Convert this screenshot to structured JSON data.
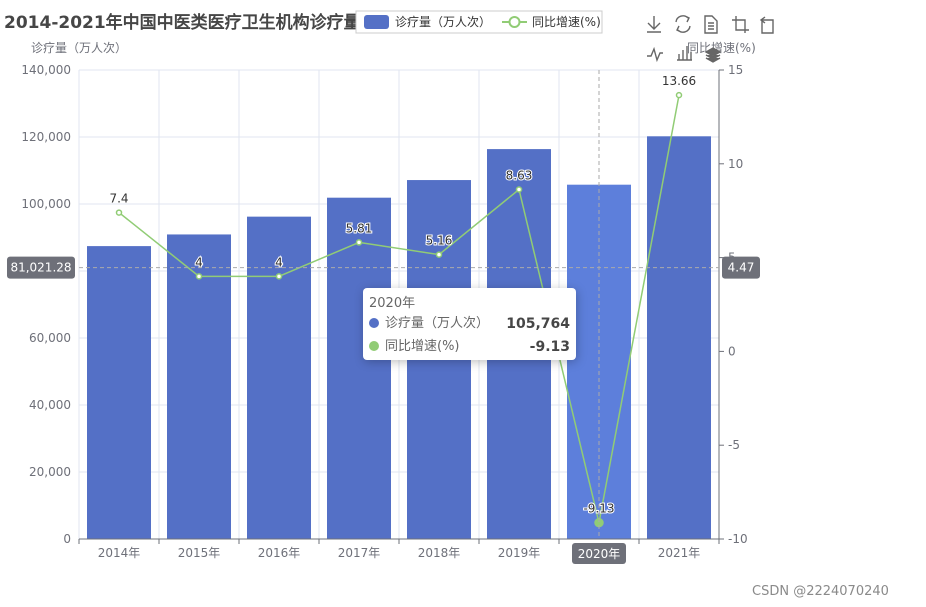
{
  "chart_data": {
    "type": "bar",
    "title": "2014-2021年中国中医类医疗卫生机构诊疗量",
    "categories": [
      "2014年",
      "2015年",
      "2016年",
      "2017年",
      "2018年",
      "2019年",
      "2020年",
      "2021年"
    ],
    "series": [
      {
        "name": "诊疗量（万人次）",
        "type": "bar",
        "axis": "left",
        "color": "#5470c6",
        "values": [
          87431,
          90912,
          96225,
          101885,
          107147,
          116390,
          105764,
          120213
        ]
      },
      {
        "name": "同比增速(%)",
        "type": "line",
        "axis": "right",
        "color": "#91cc75",
        "values": [
          7.4,
          4,
          4,
          5.81,
          5.16,
          8.63,
          -9.13,
          13.66
        ],
        "labels": [
          "7.4",
          "4",
          "4",
          "5.81",
          "5.16",
          "8.63",
          "-9.13",
          "13.66"
        ]
      }
    ],
    "y_left": {
      "name": "诊疗量（万人次）",
      "min": 0,
      "max": 140000,
      "interval": 20000,
      "tick_labels": [
        "0",
        "20,000",
        "40,000",
        "60,000",
        "80,000",
        "100,000",
        "120,000",
        "140,000"
      ]
    },
    "y_right": {
      "name": "同比增速(%)",
      "min": -10,
      "max": 15,
      "interval": 5,
      "tick_labels": [
        "-10",
        "-5",
        "0",
        "5",
        "10",
        "15"
      ]
    },
    "legend_position": "top-center",
    "grid": true
  },
  "axis_pointer": {
    "left_value": 81021.28,
    "left_label": "81,021.28",
    "right_value": 4.47,
    "right_label": "4.47",
    "category_label": "2020年",
    "category_index": 6
  },
  "tooltip": {
    "title": "2020年",
    "rows": [
      {
        "name": "诊疗量（万人次）",
        "value": "105,764",
        "color": "#5470c6"
      },
      {
        "name": "同比增速(%)",
        "value": "-9.13",
        "color": "#91cc75"
      }
    ]
  },
  "toolbox": [
    "download-icon",
    "refresh-icon",
    "data-view-icon",
    "zoom-icon",
    "zoom-reset-icon",
    "line-switch-icon",
    "bar-switch-icon",
    "stack-icon"
  ],
  "watermark": "CSDN @2224070240"
}
